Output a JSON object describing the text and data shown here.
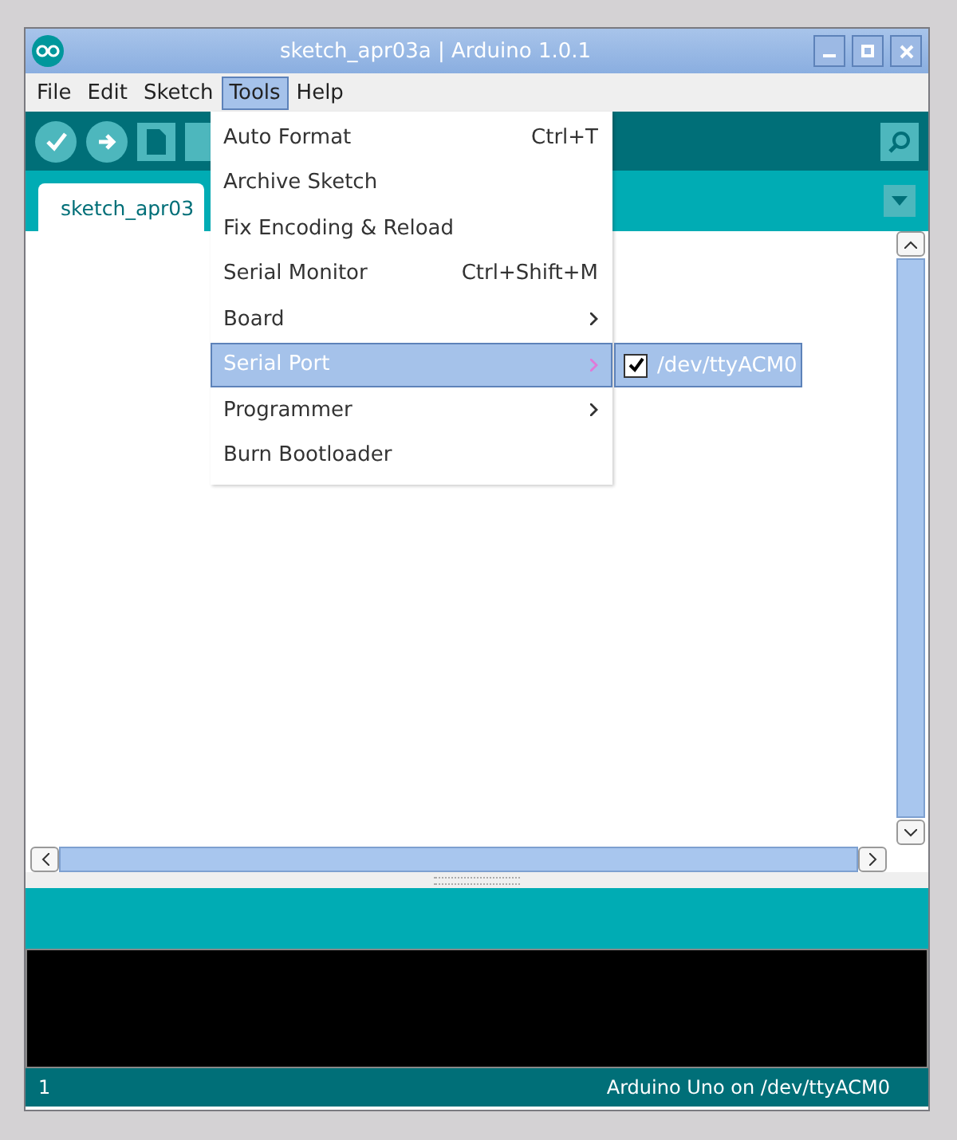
{
  "window": {
    "title": "sketch_apr03a | Arduino 1.0.1"
  },
  "menubar": [
    {
      "label": "File",
      "selected": false
    },
    {
      "label": "Edit",
      "selected": false
    },
    {
      "label": "Sketch",
      "selected": false
    },
    {
      "label": "Tools",
      "selected": true
    },
    {
      "label": "Help",
      "selected": false
    }
  ],
  "tabs": [
    {
      "label": "sketch_apr03",
      "selected": true
    }
  ],
  "tools_menu": [
    {
      "label": "Auto Format",
      "shortcut": "Ctrl+T",
      "kind": "command",
      "selected": false
    },
    {
      "label": "Archive Sketch",
      "kind": "command",
      "selected": false
    },
    {
      "label": "Fix Encoding & Reload",
      "kind": "command",
      "selected": false
    },
    {
      "label": "Serial Monitor",
      "shortcut": "Ctrl+Shift+M",
      "kind": "command",
      "selected": false
    },
    {
      "label": "Board",
      "kind": "submenu",
      "selected": false
    },
    {
      "label": "Serial Port",
      "kind": "submenu",
      "selected": true
    },
    {
      "label": "Programmer",
      "kind": "submenu",
      "selected": false
    },
    {
      "label": "Burn Bootloader",
      "kind": "command",
      "selected": false
    }
  ],
  "serial_port_menu": [
    {
      "label": "/dev/ttyACM0",
      "checked": true
    }
  ],
  "status_bar": {
    "line": "1",
    "board": "Arduino Uno on /dev/ttyACM0"
  }
}
